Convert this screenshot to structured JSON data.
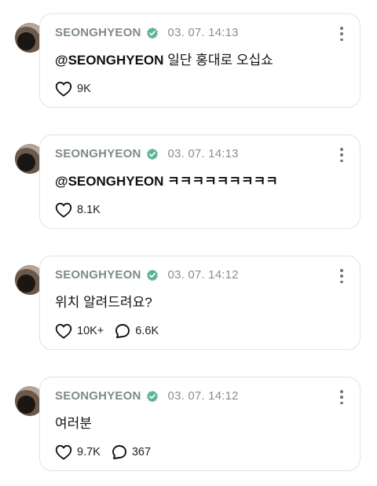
{
  "posts": [
    {
      "author": "SEONGHYEON",
      "time": "03. 07. 14:13",
      "mention": "@SEONGHYEON",
      "body": "일단 홍대로 오십쇼",
      "likes": "9K",
      "replies": null
    },
    {
      "author": "SEONGHYEON",
      "time": "03. 07. 14:13",
      "mention": "@SEONGHYEON",
      "body": "ㅋㅋㅋㅋㅋㅋㅋㅋㅋ",
      "likes": "8.1K",
      "replies": null
    },
    {
      "author": "SEONGHYEON",
      "time": "03. 07. 14:12",
      "mention": "",
      "body": "위치 알려드려요?",
      "likes": "10K+",
      "replies": "6.6K"
    },
    {
      "author": "SEONGHYEON",
      "time": "03. 07. 14:12",
      "mention": "",
      "body": "여러분",
      "likes": "9.7K",
      "replies": "367"
    }
  ],
  "icons": {
    "verified": "verified-badge-icon",
    "like": "heart-icon",
    "reply": "speech-bubble-icon",
    "more": "more-vertical-icon"
  },
  "colors": {
    "verified": "#5fb29a",
    "author": "#7f8b84",
    "timestamp": "#8c8c8c",
    "border": "#e3e3e3"
  }
}
